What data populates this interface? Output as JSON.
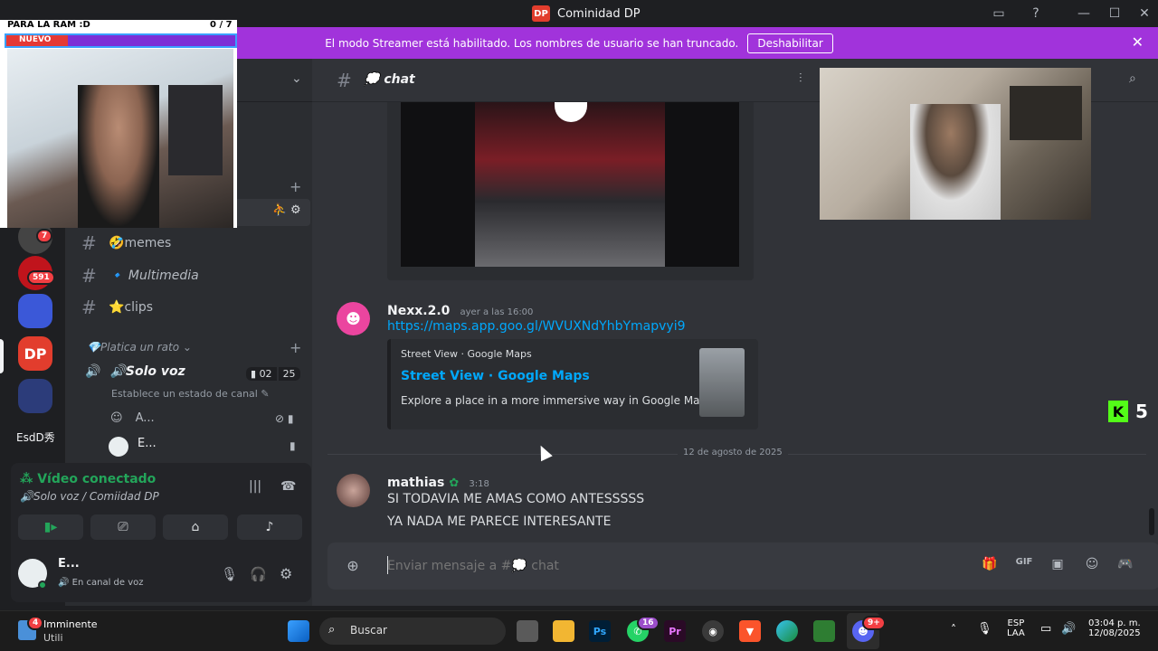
{
  "titlebar": {
    "logo": "DP",
    "title": "Cominidad DP"
  },
  "streamer_bar": {
    "message": "El modo Streamer está habilitado. Los nombres de usuario se han truncado.",
    "button": "Deshabilitar",
    "close": "✕"
  },
  "overlay": {
    "ram_label": "PARA LA RAM :D",
    "ram_count": "0 / 7",
    "new_label": "NUEVO"
  },
  "rail": {
    "badges": [
      "7",
      "591"
    ],
    "last_label": "EsdD秀"
  },
  "channels": [
    {
      "name": "memes",
      "emoji": "🤣"
    },
    {
      "name": "Multimedia",
      "emoji": "🔹"
    },
    {
      "name": "clips",
      "emoji": "⭐"
    }
  ],
  "category": {
    "name": "Platica un rato",
    "emoji": "💎"
  },
  "voice_channel": {
    "name": "Solo  voz",
    "emoji": "🔊",
    "count_a": "02",
    "count_b": "25",
    "status_hint": "Establece un estado de canal"
  },
  "voice_users": [
    "A...",
    "E..."
  ],
  "voice_panel": {
    "status": "Vídeo conectado",
    "location": "Solo  voz / Comiidad DP"
  },
  "user_panel": {
    "name": "E...",
    "status": "En canal de voz"
  },
  "chat": {
    "channel_name": "chat",
    "messages": [
      {
        "author": "Nexx.2.0",
        "time": "ayer a las 16:00",
        "link": "https://maps.app.goo.gl/WVUXNdYhbYmapvyi9",
        "embed": {
          "provider": "Street View · Google Maps",
          "title": "Street View · Google Maps",
          "description": "Explore a place in a more immersive way in Google Maps."
        }
      },
      {
        "author": "mathias",
        "time": "3:18",
        "lines": [
          "SI TODAVIA ME AMAS COMO ANTESSSSS",
          "YA NADA ME PARECE INTERESANTE"
        ]
      }
    ],
    "date_divider": "12 de agosto de 2025",
    "input_placeholder": "Enviar mensaje a #💭 chat"
  },
  "kick_widget": {
    "count": "5"
  },
  "taskbar": {
    "weather_badge": "4",
    "weather_title": "Imminente",
    "weather_sub": "Utili",
    "search": "Buscar",
    "whatsapp_badge": "16",
    "discord_badge": "9+",
    "lang_top": "ESP",
    "lang_bottom": "LAA",
    "time": "03:04 p. m.",
    "date": "12/08/2025"
  },
  "colors": {
    "accent": "#5865f2",
    "streamer": "#a133db",
    "link": "#00a8fc",
    "green": "#23a55a"
  }
}
